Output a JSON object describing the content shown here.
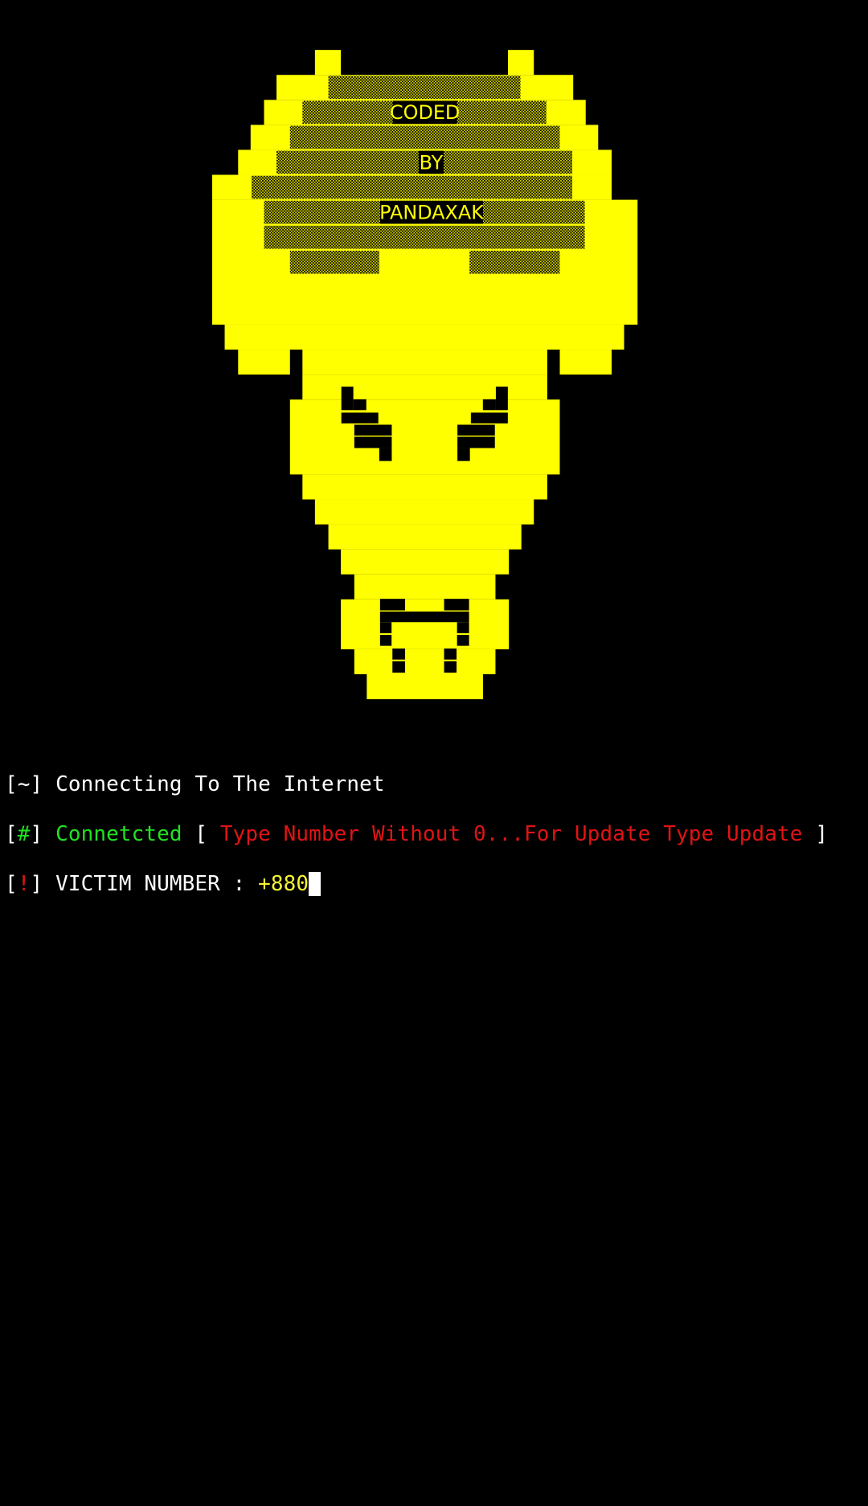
{
  "banner": {
    "line1": "CODED",
    "line2": "BY",
    "line3": "PANDAXAK",
    "art_color": "#ffff00"
  },
  "terminal": {
    "status1": {
      "prefix_open": "[",
      "symbol": "~",
      "prefix_close": "]",
      "text": "Connecting To The Internet"
    },
    "status2": {
      "prefix_open": "[",
      "symbol": "#",
      "prefix_close": "]",
      "status": "Connetcted",
      "bracket_open": "[",
      "hint": "Type Number Without 0...For Update Type Update",
      "bracket_close": "]"
    },
    "prompt": {
      "prefix_open": "[",
      "symbol": "!",
      "prefix_close": "]",
      "label": "VICTIM NUMBER :",
      "value": "+880"
    }
  },
  "colors": {
    "white": "#ffffff",
    "green": "#22e022",
    "red": "#e01414",
    "yellow": "#f5f534",
    "background": "#000000"
  }
}
